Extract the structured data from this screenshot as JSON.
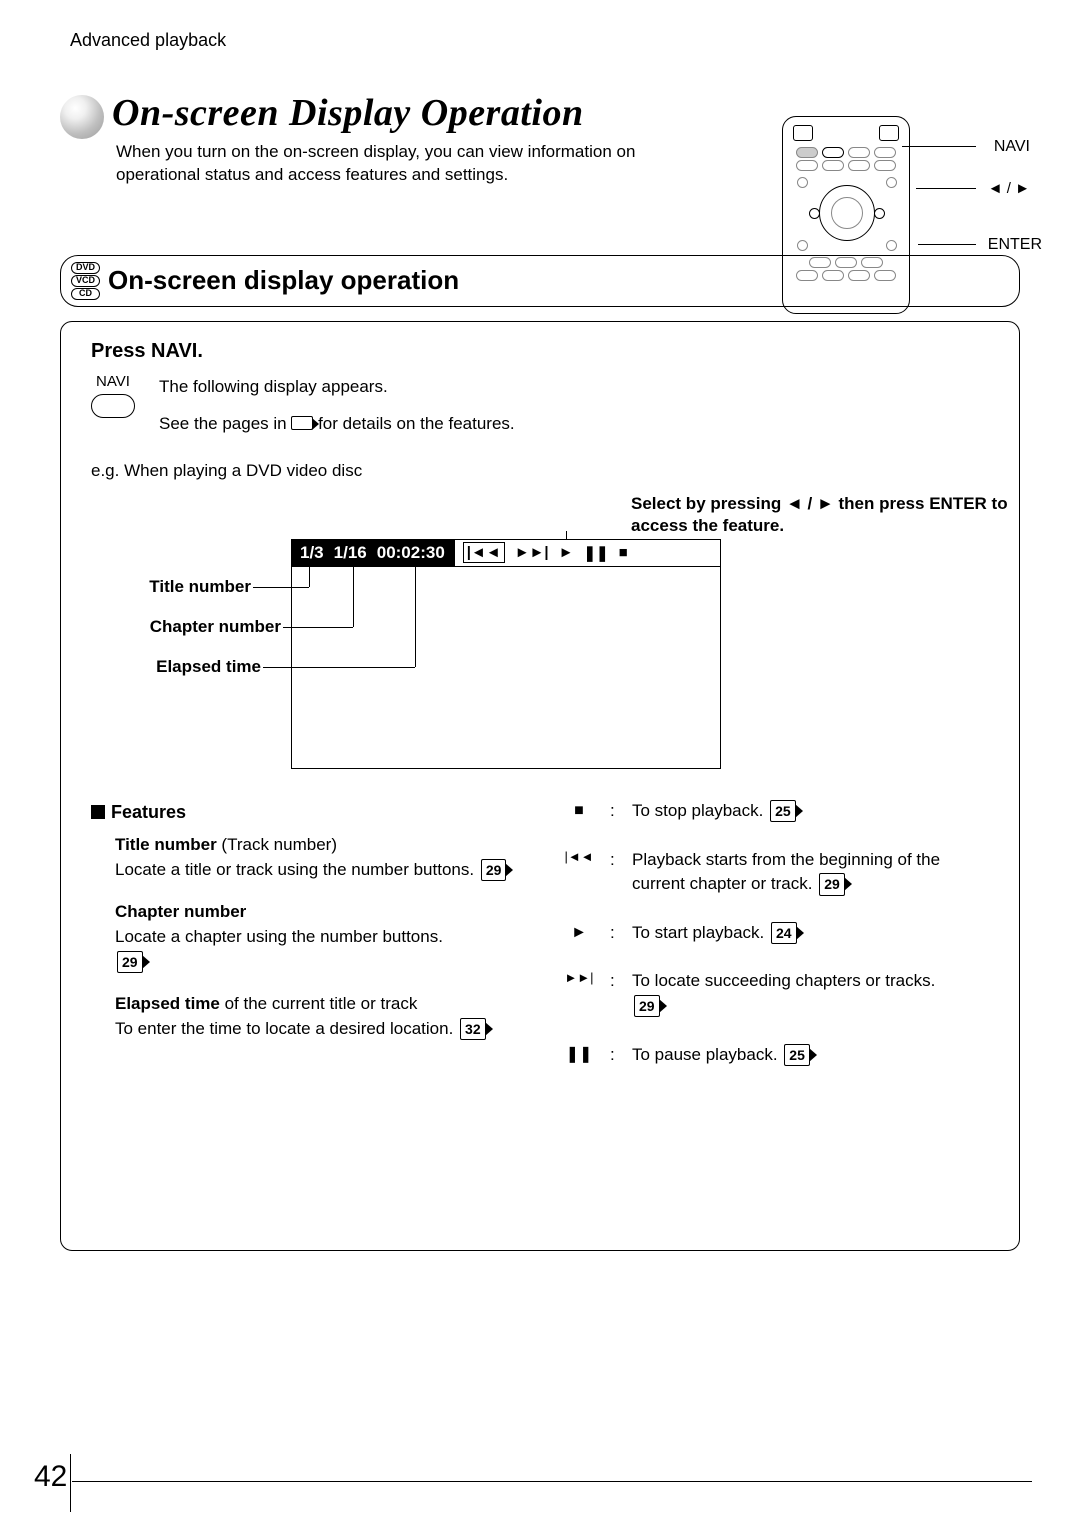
{
  "breadcrumb": "Advanced playback",
  "pageTitle": "On-screen Display Operation",
  "intro": "When you turn on the on-screen display, you can view information on operational status and access features and settings.",
  "remoteLabels": {
    "navi": "NAVI",
    "arrows": "◄ / ►",
    "enter": "ENTER"
  },
  "discBadges": [
    "DVD",
    "VCD",
    "CD"
  ],
  "sectionTitle": "On-screen display operation",
  "step": {
    "heading": "Press NAVI.",
    "naviLabel": "NAVI",
    "line1": "The following display appears.",
    "line2a": "See the pages in ",
    "line2b": " for details on the features.",
    "eg": "e.g. When playing a DVD video disc"
  },
  "osd": {
    "title": "1/3",
    "chapter": "1/16",
    "time": "00:02:30",
    "iconPrev": "|◄◄",
    "iconNext": "►►|",
    "iconPlay": "►",
    "iconPause": "❚❚",
    "iconStop": "■"
  },
  "callouts": {
    "titleNumber": "Title number",
    "chapterNumber": "Chapter number",
    "elapsedTime": "Elapsed time",
    "selectNote": "Select by pressing ◄ / ► then press ENTER  to access the  feature."
  },
  "features": {
    "heading": "Features",
    "left": [
      {
        "title": "Title number",
        "suffix": " (Track number)",
        "body": "Locate a title or track using the number buttons.",
        "page": "29"
      },
      {
        "title": "Chapter number",
        "suffix": "",
        "body": "Locate a chapter using the number buttons.",
        "page": "29"
      },
      {
        "title": "Elapsed time",
        "suffix": " of the current title or track",
        "body": "To enter the time to locate a desired location.",
        "page": "32"
      }
    ],
    "right": [
      {
        "sym": "■",
        "body": "To stop playback.",
        "page": "25"
      },
      {
        "sym": "|◄◄",
        "body": "Playback starts from the beginning of the current chapter or track.",
        "page": "29"
      },
      {
        "sym": "►",
        "body": "To start playback.",
        "page": "24"
      },
      {
        "sym": "►►|",
        "body": "To locate succeeding chapters or tracks.",
        "page": "29"
      },
      {
        "sym": "❚❚",
        "body": "To pause playback.",
        "page": "25"
      }
    ]
  },
  "pageNumber": "42"
}
